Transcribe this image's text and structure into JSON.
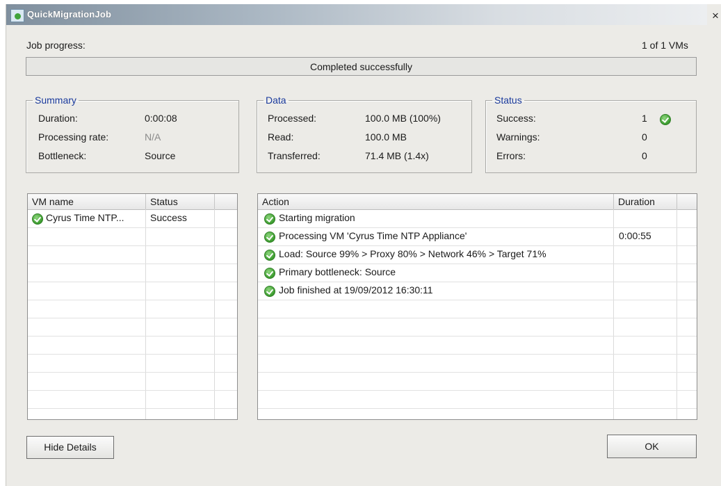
{
  "window": {
    "title": "QuickMigrationJob",
    "close_glyph": "×"
  },
  "progress": {
    "label": "Job progress:",
    "count": "1 of 1 VMs",
    "status_text": "Completed successfully",
    "percent": 100
  },
  "summary": {
    "legend": "Summary",
    "rows": [
      {
        "label": "Duration:",
        "value": "0:00:08"
      },
      {
        "label": "Processing rate:",
        "value": "N/A"
      },
      {
        "label": "Bottleneck:",
        "value": "Source"
      }
    ]
  },
  "data": {
    "legend": "Data",
    "rows": [
      {
        "label": "Processed:",
        "value": "100.0 MB (100%)"
      },
      {
        "label": "Read:",
        "value": "100.0 MB"
      },
      {
        "label": "Transferred:",
        "value": "71.4 MB (1.4x)"
      }
    ]
  },
  "status": {
    "legend": "Status",
    "rows": [
      {
        "label": "Success:",
        "value": "1"
      },
      {
        "label": "Warnings:",
        "value": "0"
      },
      {
        "label": "Errors:",
        "value": "0"
      }
    ]
  },
  "vm_table": {
    "headers": {
      "name": "VM name",
      "status": "Status"
    },
    "rows": [
      {
        "name": "Cyrus Time NTP...",
        "status": "Success"
      }
    ]
  },
  "action_table": {
    "headers": {
      "action": "Action",
      "duration": "Duration"
    },
    "rows": [
      {
        "action": "Starting migration",
        "duration": ""
      },
      {
        "action": "Processing VM 'Cyrus Time NTP Appliance'",
        "duration": "0:00:55"
      },
      {
        "action": "Load: Source 99% > Proxy 80% > Network 46% > Target 71%",
        "duration": ""
      },
      {
        "action": "Primary bottleneck: Source",
        "duration": ""
      },
      {
        "action": "Job finished at 19/09/2012 16:30:11",
        "duration": ""
      }
    ]
  },
  "buttons": {
    "hide_details": "Hide Details",
    "ok": "OK"
  },
  "icons": {
    "success": "success-check-icon",
    "app": "veeam-app-icon"
  },
  "colors": {
    "legend": "#1a3a9c",
    "success": "#3b9b2e"
  }
}
